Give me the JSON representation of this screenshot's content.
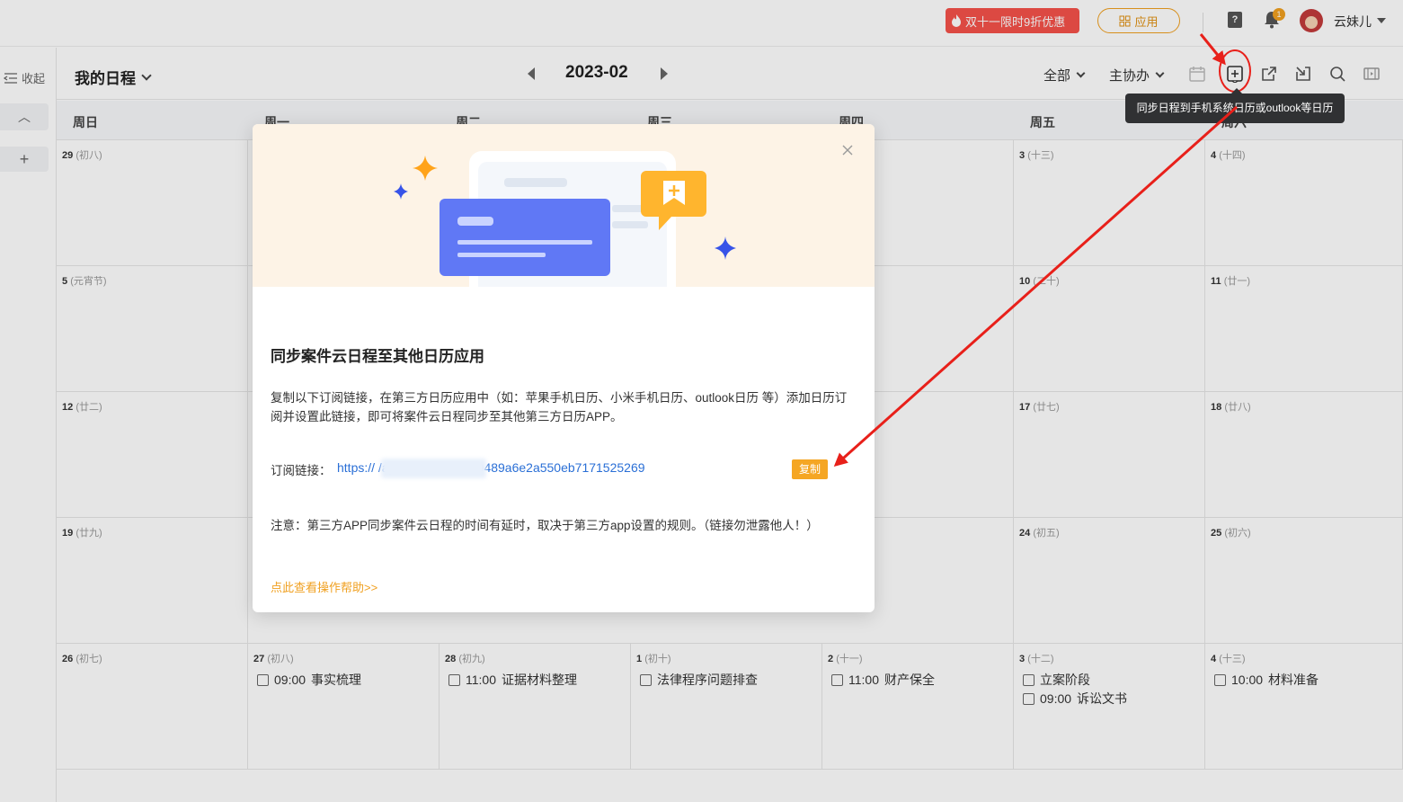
{
  "topbar": {
    "promo_label": "双十一限时9折优惠",
    "app_label": "应用",
    "bell_badge": "1",
    "username": "云妹儿"
  },
  "leftrail": {
    "collapse_label": "收起"
  },
  "header": {
    "title": "我的日程",
    "month": "2023-02",
    "filter_all": "全部",
    "filter_role": "主协办"
  },
  "tooltip": "同步日程到手机系统日历或outlook等日历",
  "weekdays": [
    "周日",
    "周一",
    "周二",
    "周三",
    "周四",
    "周五",
    "周六"
  ],
  "days": [
    {
      "num": "29",
      "lunar": "(初八)"
    },
    {
      "num": "3",
      "lunar": "(十三)"
    },
    {
      "num": "4",
      "lunar": "(十四)"
    },
    {
      "num": "5",
      "lunar": "(元宵节)"
    },
    {
      "num": "10",
      "lunar": "(二十)"
    },
    {
      "num": "11",
      "lunar": "(廿一)"
    },
    {
      "num": "12",
      "lunar": "(廿二)"
    },
    {
      "num": "17",
      "lunar": "(廿七)"
    },
    {
      "num": "18",
      "lunar": "(廿八)"
    },
    {
      "num": "19",
      "lunar": "(廿九)"
    },
    {
      "num": "24",
      "lunar": "(初五)"
    },
    {
      "num": "25",
      "lunar": "(初六)"
    },
    {
      "num": "26",
      "lunar": "(初七)"
    },
    {
      "num": "27",
      "lunar": "(初八)"
    },
    {
      "num": "28",
      "lunar": "(初九)"
    },
    {
      "num": "1",
      "lunar": "(初十)"
    },
    {
      "num": "2",
      "lunar": "(十一)"
    },
    {
      "num": "3",
      "lunar": "(十二)"
    },
    {
      "num": "4",
      "lunar": "(十三)"
    }
  ],
  "events": [
    {
      "time": "09:00",
      "text": "事实梳理"
    },
    {
      "time": "11:00",
      "text": "证据材料整理"
    },
    {
      "time": "",
      "text": "法律程序问题排查"
    },
    {
      "time": "11:00",
      "text": "财产保全"
    },
    {
      "time": "",
      "text": "立案阶段"
    },
    {
      "time": "09:00",
      "text": "诉讼文书"
    },
    {
      "time": "10:00",
      "text": "材料准备"
    }
  ],
  "modal": {
    "title": "同步案件云日程至其他日历应用",
    "desc": "复制以下订阅链接，在第三方日历应用中（如：苹果手机日历、小米手机日历、outlook日历 等）添加日历订阅并设置此链接，即可将案件云日程同步至其他第三方日历APP。",
    "sub_label": "订阅链接：",
    "sub_link": "https://                    /api/ics/2b7796d40489a6e2a550eb7171525269",
    "copy_label": "复制",
    "notice": "注意：第三方APP同步案件云日程的时间有延时，取决于第三方app设置的规则。（链接勿泄露他人！）",
    "help_link": "点此查看操作帮助>>"
  },
  "colors": {
    "accent": "#f5a623",
    "link": "#2a6fd6",
    "annotation": "#e8201a",
    "promo": "#f5524a"
  },
  "icons": [
    "fire-icon",
    "grid-icon",
    "help-icon",
    "bell-icon",
    "calendar-icon",
    "sync-calendar-icon",
    "share-icon",
    "import-icon",
    "search-icon",
    "fullscreen-icon",
    "close-icon"
  ]
}
